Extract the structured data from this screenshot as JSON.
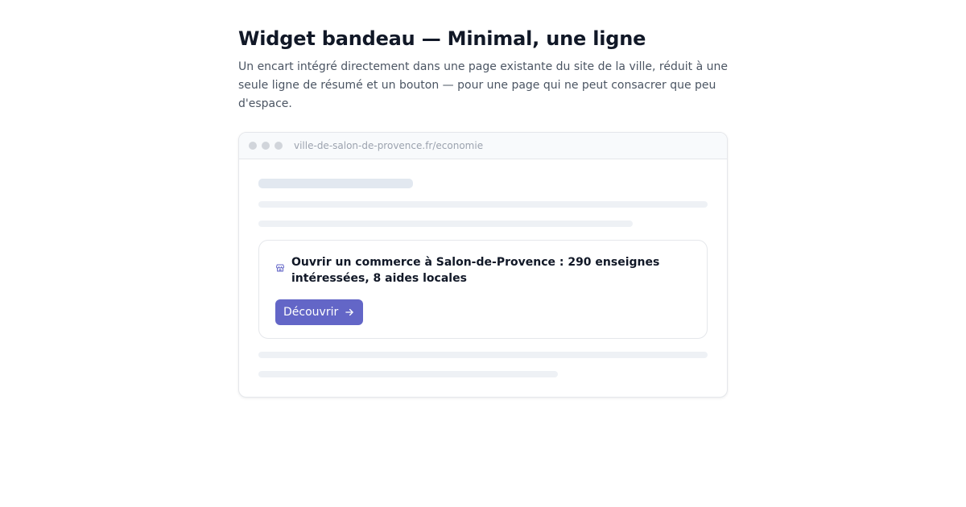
{
  "page": {
    "title": "Widget bandeau — Minimal, une ligne",
    "description": "Un encart intégré directement dans une page existante du site de la ville, réduit à une seule ligne de résumé et un bouton — pour une page qui ne peut consacrer que peu d'espace."
  },
  "browser": {
    "url": "ville-de-salon-de-provence.fr/economie"
  },
  "widget": {
    "icon": "store-icon",
    "summary": "Ouvrir un commerce à Salon-de-Provence : 290 enseignes intéressées, 8 aides locales",
    "button_label": "Découvrir",
    "button_icon": "arrow-right-icon",
    "accent_color": "#6366c7"
  }
}
